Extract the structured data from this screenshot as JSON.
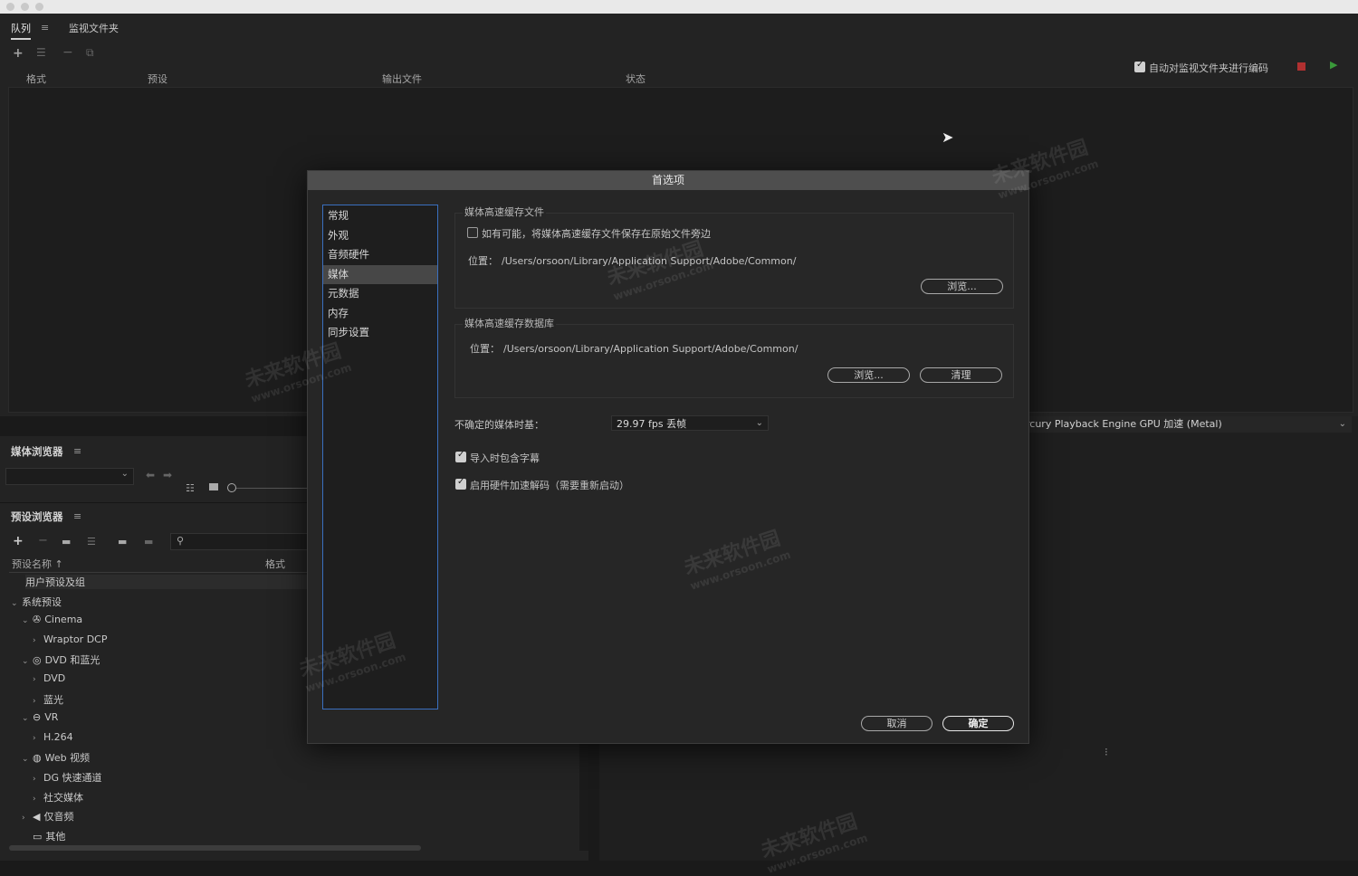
{
  "queue": {
    "tabs": [
      "队列",
      "监视文件夹"
    ],
    "menu_icon": "≡",
    "columns": [
      "格式",
      "预设",
      "输出文件",
      "状态"
    ],
    "auto_encode_label": "自动对监视文件夹进行编码",
    "auto_encode_checked": true
  },
  "media_browser": {
    "title": "媒体浏览器",
    "menu_icon": "≡"
  },
  "preset_browser": {
    "title": "预设浏览器",
    "menu_icon": "≡",
    "column_name": "预设名称 ↑",
    "column_format": "格式",
    "tree": [
      {
        "label": "用户预设及组",
        "level": 0,
        "arrow": ""
      },
      {
        "label": "系统预设",
        "level": 0,
        "arrow": "⌄"
      },
      {
        "label": "Cinema",
        "level": 1,
        "arrow": "⌄",
        "icon": "cinema-icon"
      },
      {
        "label": "Wraptor DCP",
        "level": 2,
        "arrow": "›"
      },
      {
        "label": "DVD 和蓝光",
        "level": 1,
        "arrow": "⌄",
        "icon": "disc-icon"
      },
      {
        "label": "DVD",
        "level": 2,
        "arrow": "›"
      },
      {
        "label": "蓝光",
        "level": 2,
        "arrow": "›"
      },
      {
        "label": "VR",
        "level": 1,
        "arrow": "⌄",
        "icon": "vr-icon"
      },
      {
        "label": "H.264",
        "level": 2,
        "arrow": "›"
      },
      {
        "label": "Web 视频",
        "level": 1,
        "arrow": "⌄",
        "icon": "globe-icon"
      },
      {
        "label": "DG 快速通道",
        "level": 2,
        "arrow": "›"
      },
      {
        "label": "社交媒体",
        "level": 2,
        "arrow": "›"
      },
      {
        "label": "仅音频",
        "level": 1,
        "arrow": "›",
        "icon": "speaker-icon"
      },
      {
        "label": "其他",
        "level": 1,
        "arrow": "",
        "icon": "monitor-icon"
      }
    ]
  },
  "renderer": {
    "value": "rcury Playback Engine GPU 加速 (Metal)"
  },
  "dialog": {
    "title": "首选项",
    "categories": [
      "常规",
      "外观",
      "音频硬件",
      "媒体",
      "元数据",
      "内存",
      "同步设置"
    ],
    "selected_category": "媒体",
    "cache_files": {
      "legend": "媒体高速缓存文件",
      "checkbox_label": "如有可能，将媒体高速缓存文件保存在原始文件旁边",
      "checkbox_checked": false,
      "location_label": "位置：",
      "location_path": "/Users/orsoon/Library/Application Support/Adobe/Common/",
      "browse_label": "浏览..."
    },
    "cache_db": {
      "legend": "媒体高速缓存数据库",
      "location_label": "位置：",
      "location_path": "/Users/orsoon/Library/Application Support/Adobe/Common/",
      "browse_label": "浏览...",
      "clean_label": "清理"
    },
    "timebase_label": "不确定的媒体时基：",
    "timebase_value": "29.97 fps 丢帧",
    "include_captions_label": "导入时包含字幕",
    "include_captions_checked": true,
    "hw_decode_label": "启用硬件加速解码（需要重新启动）",
    "hw_decode_checked": true,
    "cancel_label": "取消",
    "ok_label": "确定"
  },
  "watermark": {
    "brand": "未来软件园",
    "url": "www.orsoon.com"
  },
  "colors": {
    "accent_focus": "#3a6fbf",
    "stop_red": "#b03030",
    "play_green": "#3a9a3a"
  }
}
